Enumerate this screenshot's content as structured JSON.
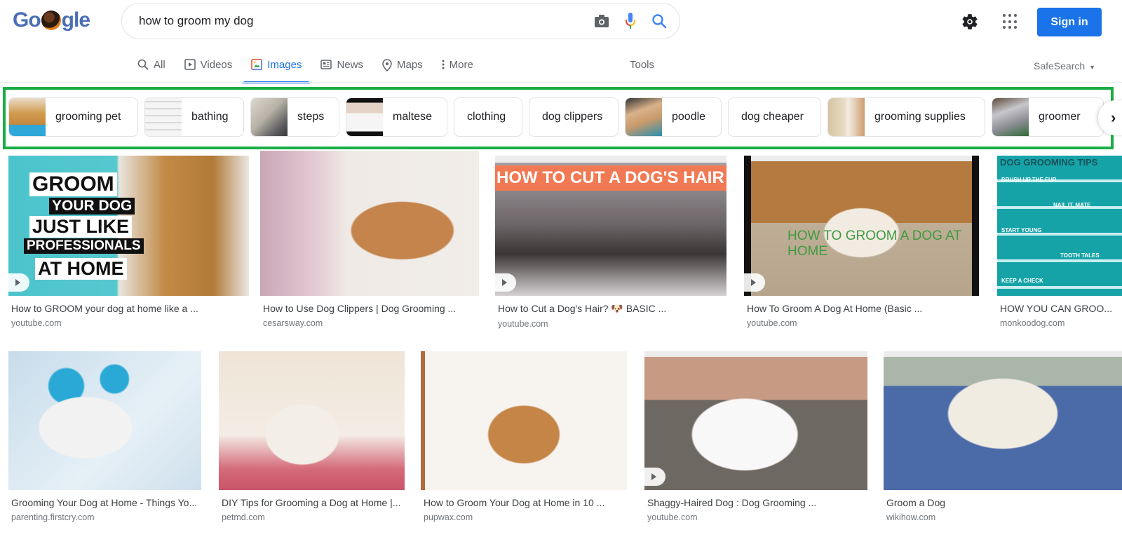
{
  "header": {
    "logo_text": [
      "Go",
      "gle"
    ],
    "search_query": "how to groom my dog",
    "search_icons": [
      "camera-icon",
      "microphone-icon",
      "search-icon"
    ],
    "settings_icon": "gear-icon",
    "apps_icon": "apps-grid-icon",
    "sign_in_label": "Sign in",
    "accent_color": "#1a73e8"
  },
  "tabs": [
    {
      "label": "All",
      "icon": "search-icon",
      "active": false
    },
    {
      "label": "Videos",
      "icon": "video-icon",
      "active": false
    },
    {
      "label": "Images",
      "icon": "image-icon",
      "active": true
    },
    {
      "label": "News",
      "icon": "news-icon",
      "active": false
    },
    {
      "label": "Maps",
      "icon": "map-pin-icon",
      "active": false
    },
    {
      "label": "More",
      "icon": "more-vert-icon",
      "active": false
    }
  ],
  "tools_label": "Tools",
  "safesearch_label": "SafeSearch",
  "chips": [
    {
      "label": "grooming pet",
      "has_thumb": true
    },
    {
      "label": "bathing",
      "has_thumb": true
    },
    {
      "label": "steps",
      "has_thumb": true
    },
    {
      "label": "maltese",
      "has_thumb": true
    },
    {
      "label": "clothing",
      "has_thumb": false
    },
    {
      "label": "dog clippers",
      "has_thumb": false
    },
    {
      "label": "poodle",
      "has_thumb": true
    },
    {
      "label": "dog cheaper",
      "has_thumb": false
    },
    {
      "label": "grooming supplies",
      "has_thumb": true
    },
    {
      "label": "groomer",
      "has_thumb": true
    }
  ],
  "chips_highlight_color": "#1aad45",
  "results_row1": [
    {
      "title": "How to GROOM your dog at home like a ...",
      "source": "youtube.com",
      "video": true,
      "overlay": [
        "GROOM",
        "YOUR DOG",
        "JUST LIKE",
        "PROFESSIONALS",
        "AT HOME"
      ]
    },
    {
      "title": "How to Use Dog Clippers | Dog Grooming ...",
      "source": "cesarsway.com",
      "video": false
    },
    {
      "title": "How to Cut a Dog's Hair? 🐶 BASIC ...",
      "source": "youtube.com",
      "video": true,
      "overlay": [
        "HOW TO CUT A DOG'S HAIR"
      ]
    },
    {
      "title": "How To Groom A Dog At Home (Basic ...",
      "source": "youtube.com",
      "video": true,
      "overlay": [
        "HOW TO GROOM A DOG AT HOME"
      ]
    },
    {
      "title": "HOW YOU CAN GROO...",
      "source": "monkoodog.com",
      "video": false,
      "overlay": [
        "DOG GROOMING TIPS",
        "BRUSH UP THE FUR",
        "NAIL IT, MATE",
        "START YOUNG",
        "TOOTH TALES",
        "KEEP A CHECK"
      ]
    }
  ],
  "results_row2": [
    {
      "title": "Grooming Your Dog at Home - Things Yo...",
      "source": "parenting.firstcry.com",
      "video": false
    },
    {
      "title": "DIY Tips for Grooming a Dog at Home |...",
      "source": "petmd.com",
      "video": false
    },
    {
      "title": "How to Groom Your Dog at Home in 10 ...",
      "source": "pupwax.com",
      "video": false
    },
    {
      "title": "Shaggy-Haired Dog : Dog Grooming ...",
      "source": "youtube.com",
      "video": true
    },
    {
      "title": "Groom a Dog",
      "source": "wikihow.com",
      "video": false
    }
  ]
}
